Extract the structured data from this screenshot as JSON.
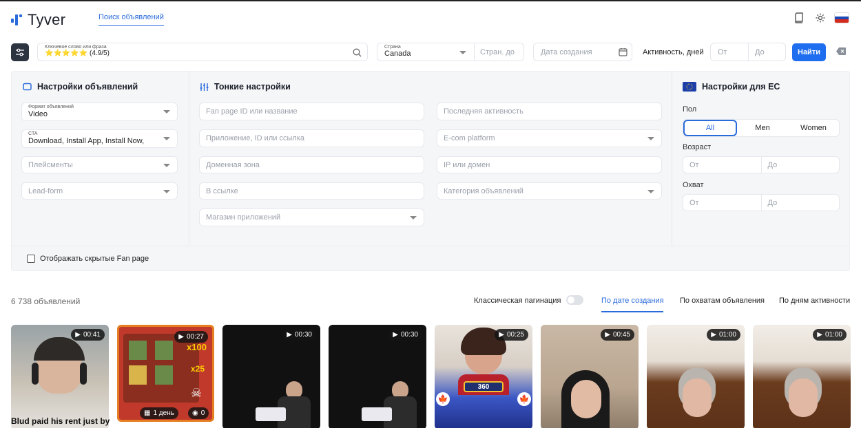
{
  "header": {
    "brand": "Tyver",
    "nav_link": "Поиск объявлений",
    "icons": [
      "book-icon",
      "gear-icon",
      "russia-flag-icon"
    ]
  },
  "search": {
    "keyword_caption": "Ключевое слово или фраза",
    "keyword_value": "⭐⭐⭐⭐⭐ (4.9/5)",
    "country_caption": "Страна",
    "country_value": "Canada",
    "country_exclude_placeholder": "Стран. до",
    "date_placeholder": "Дата создания",
    "activity_label": "Активность, дней",
    "activity_from_placeholder": "От",
    "activity_to_placeholder": "До",
    "search_button": "Найти"
  },
  "panel": {
    "ads_settings": {
      "title": "Настройки объявлений",
      "format_caption": "Формат объявлений",
      "format_value": "Video",
      "cta_caption": "CTA",
      "cta_value": "Download, Install App, Install Now, I",
      "placements_placeholder": "Плейсменты",
      "leadform_placeholder": "Lead-form"
    },
    "fine_settings": {
      "title": "Тонкие настройки",
      "fanpage_placeholder": "Fan page ID или название",
      "app_placeholder": "Приложение, ID или ссылка",
      "domain_zone_placeholder": "Доменная зона",
      "in_link_placeholder": "В ссылке",
      "app_store_placeholder": "Магазин приложений",
      "last_activity_placeholder": "Последняя активность",
      "ecom_placeholder": "E-com platform",
      "ip_placeholder": "IP или домен",
      "category_placeholder": "Категория объявлений"
    },
    "eu_settings": {
      "title": "Настройки для ЕС",
      "gender_label": "Пол",
      "gender_options": [
        "All",
        "Men",
        "Women"
      ],
      "gender_selected": "All",
      "age_label": "Возраст",
      "age_from_placeholder": "От",
      "age_to_placeholder": "До",
      "reach_label": "Охват",
      "reach_from_placeholder": "От",
      "reach_to_placeholder": "До"
    },
    "show_hidden_label": "Отображать скрытые Fan page"
  },
  "results": {
    "count": "6 738 объявлений",
    "pagination_label": "Классическая пагинация",
    "sort_options": [
      "По дате создания",
      "По охватам объявления",
      "По дням активности"
    ],
    "sort_selected": "По дате создания"
  },
  "cards": [
    {
      "duration": "00:41",
      "title": "Blud paid his rent just by"
    },
    {
      "duration": "00:27",
      "badge_days": "1 день",
      "badge_views": "0"
    },
    {
      "duration": "00:30"
    },
    {
      "duration": "00:30"
    },
    {
      "duration": "00:25",
      "overlay_number": "360"
    },
    {
      "duration": "00:45"
    },
    {
      "duration": "01:00"
    },
    {
      "duration": "01:00"
    }
  ],
  "colors": {
    "accent": "#1f6ef0",
    "dark_button": "#2c3440",
    "panel_bg": "#f5f6f8"
  }
}
